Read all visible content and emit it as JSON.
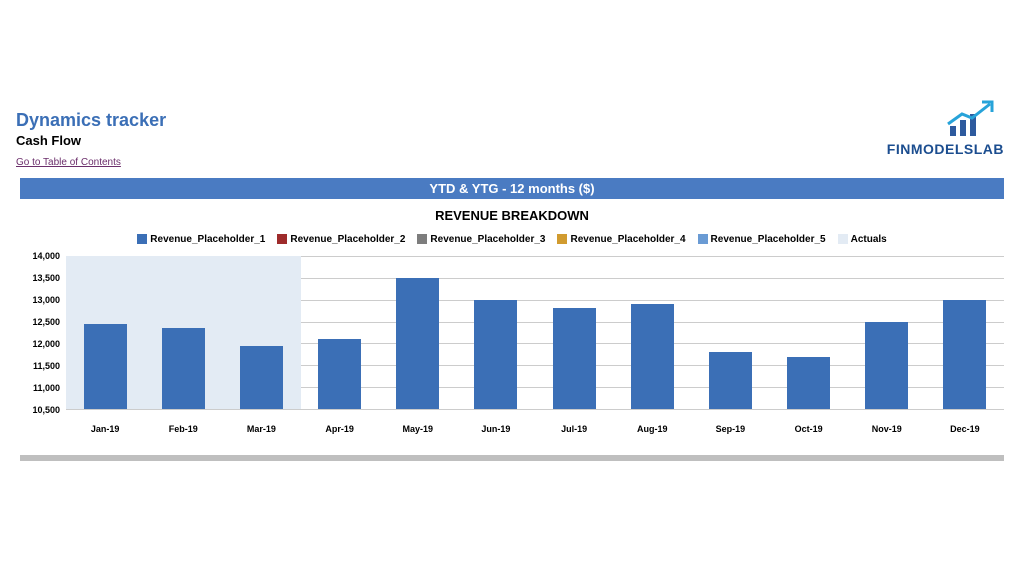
{
  "header": {
    "title": "Dynamics tracker",
    "subtitle": "Cash Flow",
    "toc_link": "Go to Table of Contents"
  },
  "logo": {
    "text": "FINMODELSLAB"
  },
  "section_bar": "YTD & YTG - 12 months ($)",
  "chart_title": "REVENUE BREAKDOWN",
  "legend": [
    {
      "label": "Revenue_Placeholder_1",
      "color": "#3b6fb6"
    },
    {
      "label": "Revenue_Placeholder_2",
      "color": "#9e2b2b"
    },
    {
      "label": "Revenue_Placeholder_3",
      "color": "#7d7d7d"
    },
    {
      "label": "Revenue_Placeholder_4",
      "color": "#d19b2f"
    },
    {
      "label": "Revenue_Placeholder_5",
      "color": "#6a9bd4"
    },
    {
      "label": "Actuals",
      "color": "#e3ebf4"
    }
  ],
  "chart_data": {
    "type": "bar",
    "title": "REVENUE BREAKDOWN",
    "xlabel": "",
    "ylabel": "",
    "ylim": [
      10500,
      14000
    ],
    "y_ticks": [
      10500,
      11000,
      11500,
      12000,
      12500,
      13000,
      13500,
      14000
    ],
    "categories": [
      "Jan-19",
      "Feb-19",
      "Mar-19",
      "Apr-19",
      "May-19",
      "Jun-19",
      "Jul-19",
      "Aug-19",
      "Sep-19",
      "Oct-19",
      "Nov-19",
      "Dec-19"
    ],
    "series": [
      {
        "name": "Revenue_Placeholder_1",
        "color": "#3b6fb6",
        "values": [
          12450,
          12350,
          11950,
          12100,
          13500,
          13000,
          12800,
          12900,
          11800,
          11700,
          12500,
          13000
        ]
      }
    ],
    "actuals_band_end_index": 3
  }
}
